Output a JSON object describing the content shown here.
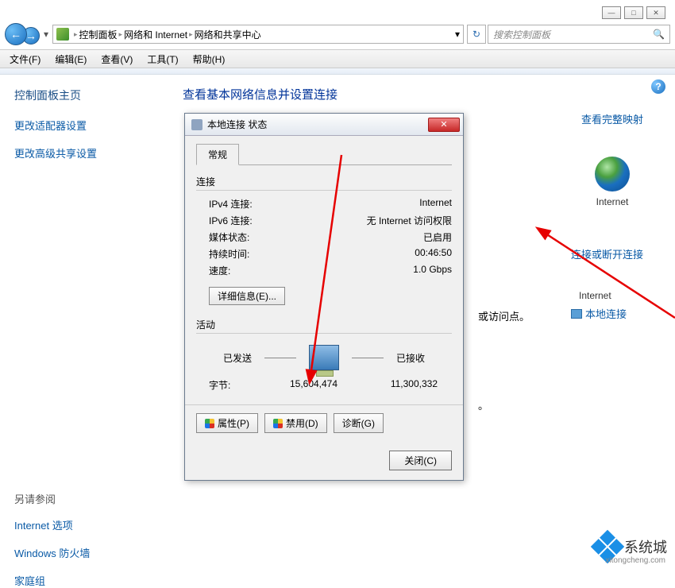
{
  "window_controls": {
    "min": "—",
    "max": "□",
    "close": "✕"
  },
  "breadcrumb": {
    "items": [
      "控制面板",
      "网络和 Internet",
      "网络和共享中心"
    ],
    "drop": "▾"
  },
  "search": {
    "placeholder": "搜索控制面板"
  },
  "menubar": [
    "文件(F)",
    "编辑(E)",
    "查看(V)",
    "工具(T)",
    "帮助(H)"
  ],
  "sidebar": {
    "title": "控制面板主页",
    "links": [
      "更改适配器设置",
      "更改高级共享设置"
    ],
    "see_also_title": "另请参阅",
    "see_also": [
      "Internet 选项",
      "Windows 防火墙",
      "家庭组"
    ]
  },
  "content": {
    "heading": "查看基本网络信息并设置连接",
    "full_map": "查看完整映射",
    "globe_label": "Internet",
    "connect_or_disconnect": "连接或断开连接",
    "internet_label": "Internet",
    "local_connection": "本地连接",
    "access_suffix": "或访问点。",
    "below_text": "。"
  },
  "dialog": {
    "title": "本地连接 状态",
    "tab": "常规",
    "section_conn": "连接",
    "ipv4_label": "IPv4 连接:",
    "ipv4_value": "Internet",
    "ipv6_label": "IPv6 连接:",
    "ipv6_value": "无 Internet 访问权限",
    "media_label": "媒体状态:",
    "media_value": "已启用",
    "duration_label": "持续时间:",
    "duration_value": "00:46:50",
    "speed_label": "速度:",
    "speed_value": "1.0 Gbps",
    "details_btn": "详细信息(E)...",
    "section_activity": "活动",
    "sent_label": "已发送",
    "recv_label": "已接收",
    "bytes_label": "字节:",
    "bytes_sent": "15,604,474",
    "bytes_recv": "11,300,332",
    "btn_properties": "属性(P)",
    "btn_disable": "禁用(D)",
    "btn_diagnose": "诊断(G)",
    "btn_close": "关闭(C)"
  },
  "watermark": {
    "brand": "系统城",
    "url": "xitongcheng.com"
  }
}
